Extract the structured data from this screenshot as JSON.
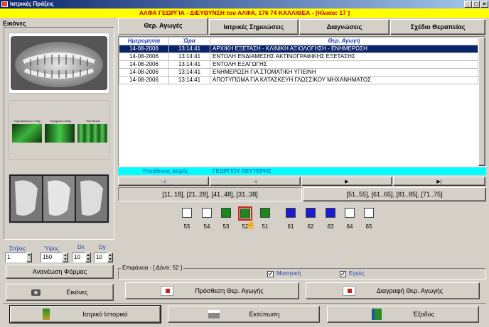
{
  "window": {
    "title": "Ιατρικές Πράξεις"
  },
  "patient_bar": "ΑΛΦΑ ΓΕΩΡΓΙΑ - ΔΙΕΥΘΥΝΣΗ του ΑΛΦΑ, 176 74 ΚΑΛΛΙΘΕΑ - [Ηλικία: 17 ]",
  "left": {
    "panel_title": "Εικόνες",
    "xray_thumbs": [
      "Cephalometric X-Ray",
      "Pyrogenic X-Ray",
      "TMJ Series"
    ],
    "spinners": [
      {
        "label": "Στήλες",
        "value": "1"
      },
      {
        "label": "Ύψος",
        "value": "150"
      },
      {
        "label": "Dx",
        "value": "10"
      },
      {
        "label": "Dy",
        "value": "10"
      }
    ],
    "refresh_label": "Ανανέωση Φόρμας",
    "images_label": "Εικόνες"
  },
  "tabs": [
    {
      "label": "Θερ. Αγωγές"
    },
    {
      "label": "Ιατρικές Σημειώσεις"
    },
    {
      "label": "Διαγνώσεις"
    },
    {
      "label": "Σχέδιο Θεραπείας"
    }
  ],
  "grid": {
    "headers": [
      "Ημερομηνία",
      "Ώρα",
      "Θερ. Αγωγή"
    ],
    "rows": [
      [
        "14-08-2006",
        "13:14:41",
        "ΑΡΧΙΚΗ ΕΞΕΤΑΣΗ - ΚΛΙΝΙΚΗ ΑΞΙΟΛΟΓΗΣΗ - ΕΝΗΜΕΡΩΣΗ"
      ],
      [
        "14-08-2006",
        "13:14:41",
        "ΕΝΤΟΛΗ ΕΝΔΙΑΜΕΣΗΣ ΑΚΤΙΝΟΓΡΑΦΙΚΗΣ ΕΞΕΤΑΣΗΣ"
      ],
      [
        "14-08-2006",
        "13:14:41",
        "ΕΝΤΟΛΗ ΕΞΑΓΩΓΗΣ"
      ],
      [
        "14-08-2006",
        "13:14:41",
        "ΕΝΗΜΕΡΩΣΗ ΓΙΑ ΣΤΟΜΑΤΙΚΗ ΥΓΙΕΙΝΗ"
      ],
      [
        "14-08-2006",
        "13:14:41",
        "ΑΠΟΤΥΠΩΜΑ ΓΙΑ ΚΑΤΑΣΚΕΥΗ ΓΛΩΣΣΙΚΟΥ ΜΗΧΑΝΗΜΑΤΟΣ"
      ]
    ]
  },
  "doctor": {
    "label": "Υπεύθυνος Ιατρός",
    "value": "ΓΕΩΡΓΙΟΥ ΛΕΥΤΕΡΗΣ"
  },
  "quadrants": {
    "left": "[11..18], [21..28], [41..48], [31..38]",
    "right": "[51..55], [61..65], [81..85], [71..75]"
  },
  "teeth": [
    {
      "num": "55",
      "color": "#ffffff"
    },
    {
      "num": "54",
      "color": "#ffffff"
    },
    {
      "num": "53",
      "color": "#1a8a1a"
    },
    {
      "num": "52",
      "color": "#1a8a1a"
    },
    {
      "num": "51",
      "color": "#1a8a1a"
    },
    {
      "num": "61",
      "color": "#1a1ad0"
    },
    {
      "num": "62",
      "color": "#1a1ad0"
    },
    {
      "num": "63",
      "color": "#1a1ad0"
    },
    {
      "num": "64",
      "color": "#ffffff"
    },
    {
      "num": "65",
      "color": "#ffffff"
    }
  ],
  "surface": {
    "title": "Επιφάνεια - [ Δόντι: 52 ]",
    "mastikí": "Μασητική",
    "engýs": "Εγγύς"
  },
  "actions": {
    "add": "Πρόσθεση Θερ. Αγωγής",
    "remove": "Διαγραφή Θερ. Αγωγής"
  },
  "bottom": {
    "history": "Ιατρικό Ιστορικό",
    "print": "Εκτύπωση",
    "exit": "Έξοδος"
  }
}
